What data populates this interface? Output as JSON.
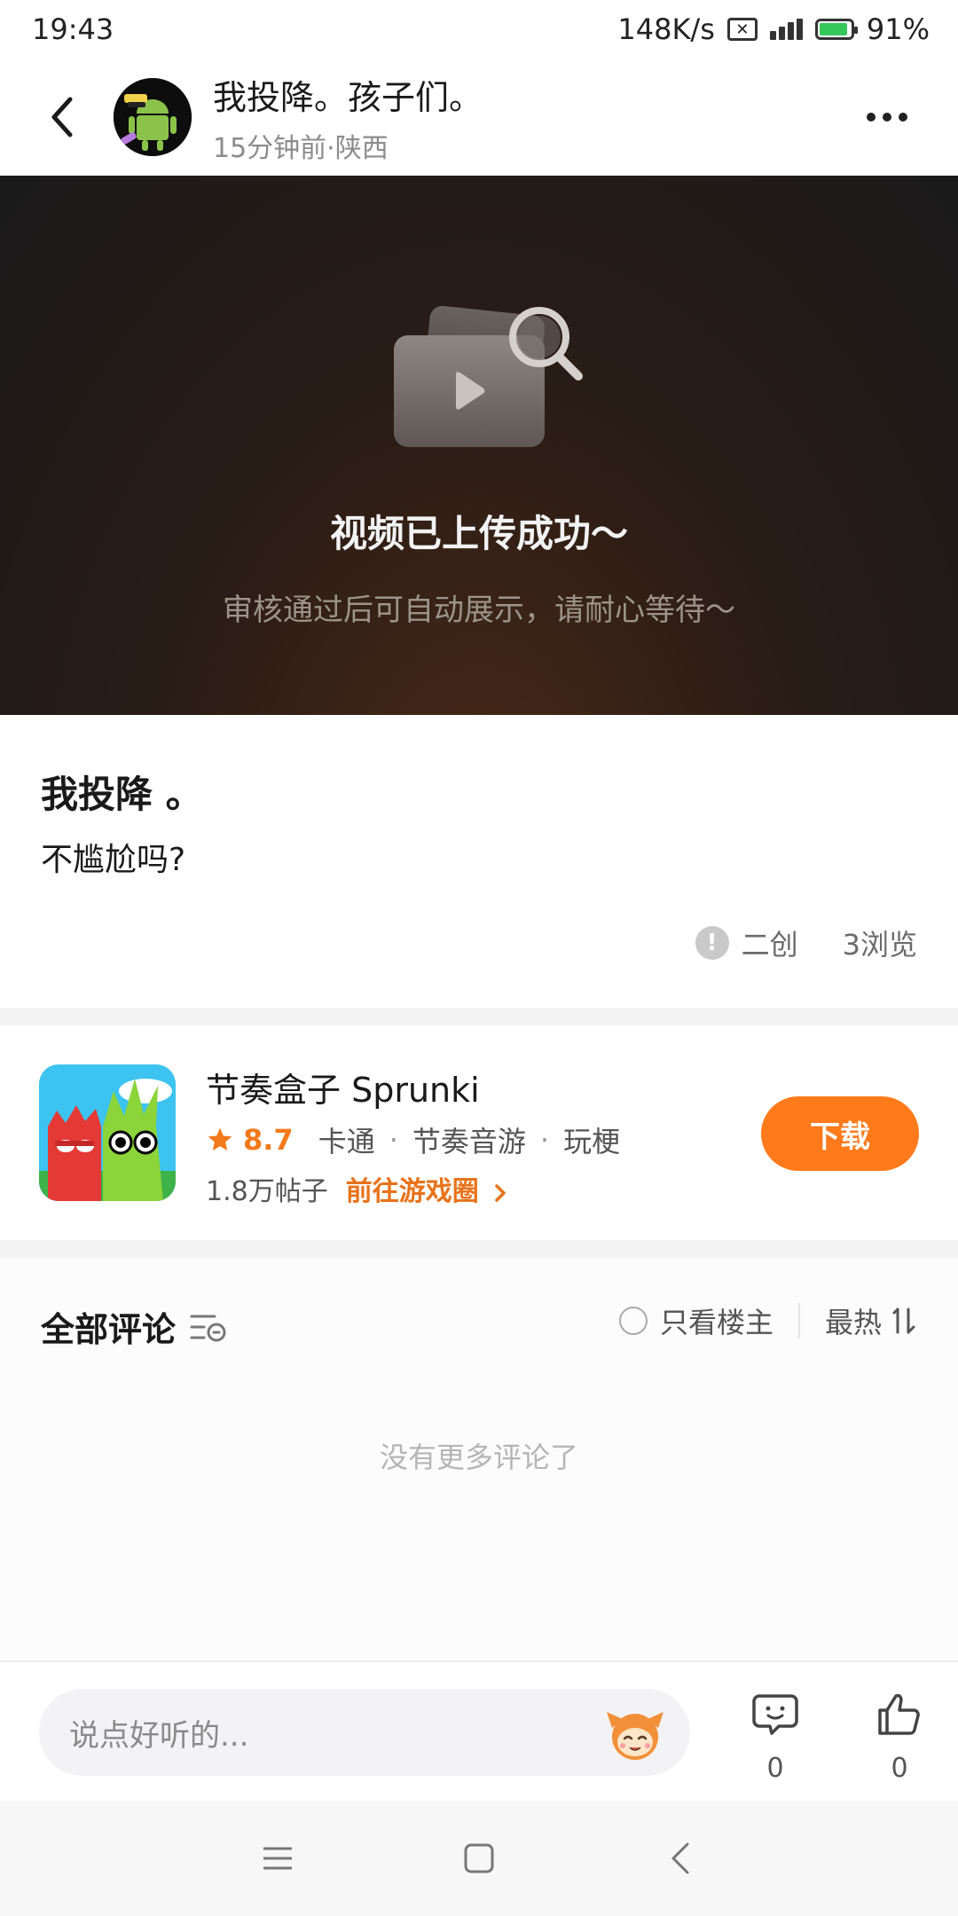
{
  "status": {
    "time": "19:43",
    "speed": "148K/s",
    "battery": "91%"
  },
  "header": {
    "title": "我投降。孩子们。",
    "subtitle": "15分钟前·陕西"
  },
  "video": {
    "title": "视频已上传成功～",
    "subtitle": "审核通过后可自动展示，请耐心等待～"
  },
  "post": {
    "title": "我投降 。",
    "body": "不尴尬吗?",
    "tag": "二创",
    "views": "3浏览"
  },
  "game": {
    "name": "节奏盒子 Sprunki",
    "rating": "8.7",
    "tags": [
      "卡通",
      "节奏音游",
      "玩梗"
    ],
    "posts": "1.8万帖子",
    "goto": "前往游戏圈",
    "download": "下载"
  },
  "comments": {
    "title": "全部评论",
    "only_owner": "只看楼主",
    "sort": "最热",
    "empty": "没有更多评论了"
  },
  "inputbar": {
    "placeholder": "说点好听的...",
    "comment_count": "0",
    "like_count": "0"
  },
  "colors": {
    "accent": "#ff7a1a",
    "video_bg": "#2a1c16"
  }
}
